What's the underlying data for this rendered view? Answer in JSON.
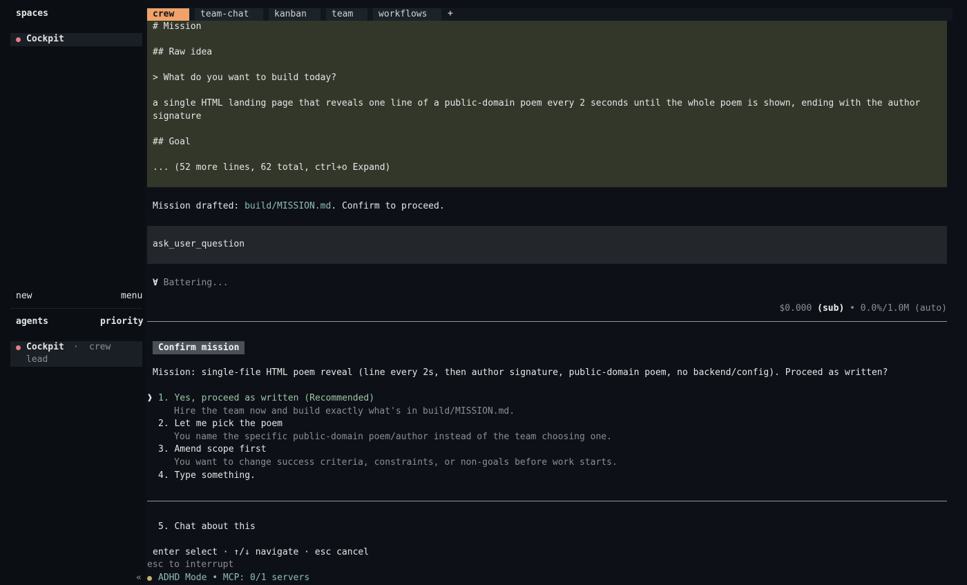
{
  "sidebar": {
    "spaces_title": "spaces",
    "spaces": [
      {
        "label": "Cockpit"
      }
    ],
    "new_label": "new",
    "menu_label": "menu",
    "agents_title": "agents",
    "priority_label": "priority",
    "agents": [
      {
        "name": "Cockpit",
        "sep": " · ",
        "role_line1": "crew",
        "role_line2": "lead"
      }
    ]
  },
  "tabs": [
    {
      "label": "crew",
      "active": true
    },
    {
      "label": "team-chat"
    },
    {
      "label": "kanban"
    },
    {
      "label": "team"
    },
    {
      "label": "workflows"
    },
    {
      "label": "+"
    }
  ],
  "mission_block": {
    "lines": [
      "# Mission",
      "## Raw idea",
      "> What do you want to build today?",
      "a single HTML landing page that reveals one line of a public-domain poem every 2 seconds until the whole poem is shown, ending with the author",
      "signature",
      "## Goal",
      "... (52 more lines, 62 total, ctrl+o Expand)"
    ]
  },
  "drafted": {
    "prefix": "Mission drafted: ",
    "path": "build/MISSION.md",
    "suffix": ". Confirm to proceed."
  },
  "tool_call": "ask_user_question",
  "status": {
    "spinner": "∀",
    "text": " Battering..."
  },
  "cost": {
    "amount": "$0.000",
    "plan": "(sub)",
    "bullet": " • ",
    "context": "0.0%/1.0M (auto)"
  },
  "question": {
    "badge": "Confirm mission",
    "text": "Mission: single-file HTML poem reveal (line every 2s, then author signature, public-domain poem, no backend/config). Proceed as written?",
    "pointer": "❱",
    "options": [
      {
        "label": "1. Yes, proceed as written (Recommended)",
        "desc": "Hire the team now and build exactly what's in build/MISSION.md."
      },
      {
        "label": "2. Let me pick the poem",
        "desc": "You name the specific public-domain poem/author instead of the team choosing one."
      },
      {
        "label": "3. Amend scope first",
        "desc": "You want to change success criteria, constraints, or non-goals before work starts."
      },
      {
        "label": "4. Type something.",
        "desc": ""
      }
    ],
    "chat_option": "5. Chat about this",
    "hint": "enter select · ↑/↓ navigate · esc cancel"
  },
  "footer": {
    "interrupt": "esc to interrupt",
    "collapse": "«",
    "mode": "ADHD Mode • MCP: 0/1 servers"
  },
  "colors": {
    "accent_tab": "#f0a26a",
    "status_dot": "#e67c8a",
    "mode_dot": "#c7b266",
    "mission_bg": "#33372a"
  }
}
